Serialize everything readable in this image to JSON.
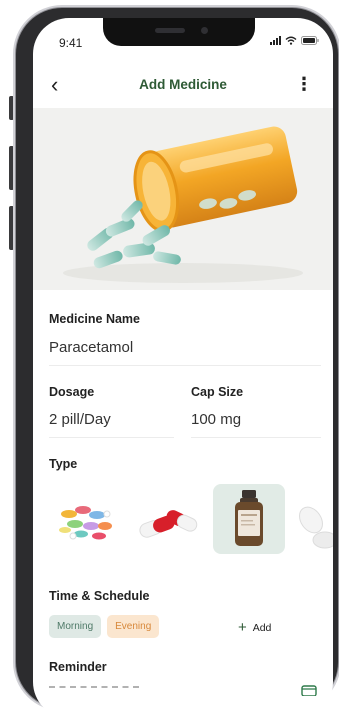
{
  "status": {
    "time": "9:41"
  },
  "header": {
    "title": "Add Medicine"
  },
  "form": {
    "medicine_name": {
      "label": "Medicine Name",
      "value": "Paracetamol"
    },
    "dosage": {
      "label": "Dosage",
      "value": "2 pill/Day"
    },
    "cap_size": {
      "label": "Cap Size",
      "value": "100 mg"
    },
    "type": {
      "label": "Type"
    },
    "schedule": {
      "label": "Time & Schedule",
      "chips": [
        "Morning",
        "Evening"
      ],
      "add_label": "Add"
    },
    "reminder": {
      "label": "Reminder"
    }
  },
  "colors": {
    "title_green": "#2e5a35",
    "morning_chip_bg": "#dfe9e5",
    "morning_chip_text": "#4f7a68",
    "evening_chip_bg": "#fbe6cf",
    "evening_chip_text": "#d7883b",
    "selected_type_bg": "#e1ebe6"
  }
}
